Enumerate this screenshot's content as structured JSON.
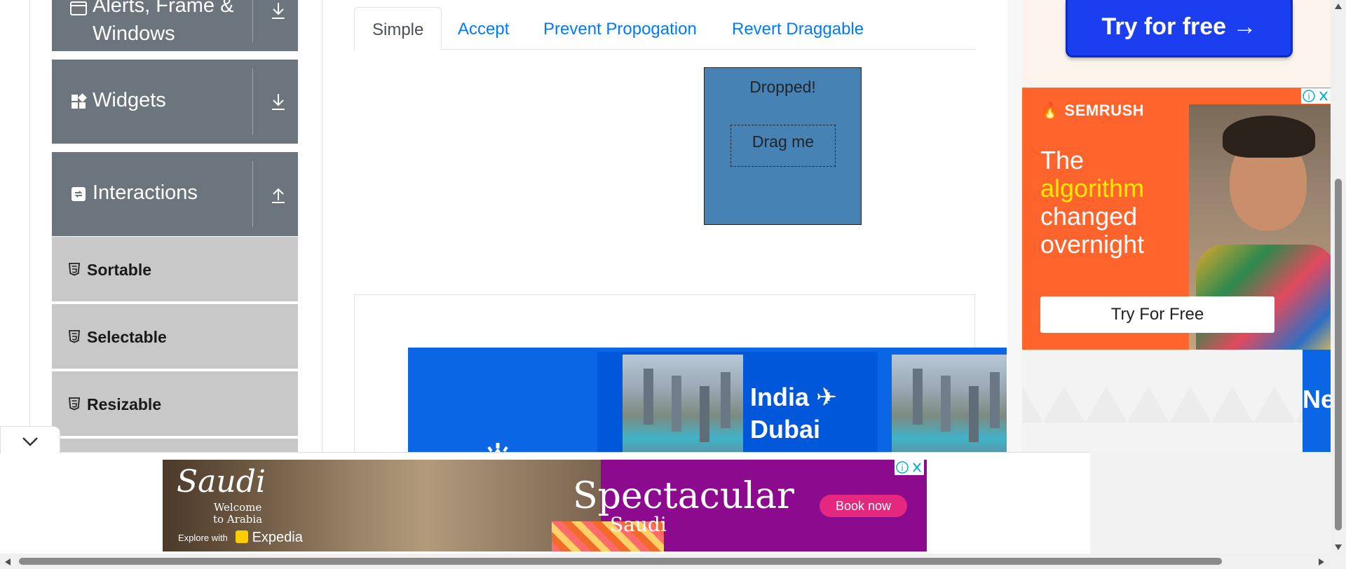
{
  "sidebar": {
    "groups": [
      {
        "label": "Alerts, Frame &\nWindows",
        "icon": "window-icon",
        "toggle": "down-arrow-icon"
      },
      {
        "label": "Widgets",
        "icon": "widgets-icon",
        "toggle": "down-arrow-icon"
      },
      {
        "label": "Interactions",
        "icon": "interactions-icon",
        "toggle": "up-arrow-icon"
      }
    ],
    "items": [
      {
        "label": "Sortable",
        "icon": "html5-icon"
      },
      {
        "label": "Selectable",
        "icon": "html5-icon"
      },
      {
        "label": "Resizable",
        "icon": "html5-icon"
      }
    ]
  },
  "tabs": [
    {
      "label": "Simple",
      "active": true
    },
    {
      "label": "Accept",
      "active": false
    },
    {
      "label": "Prevent Propogation",
      "active": false
    },
    {
      "label": "Revert Draggable",
      "active": false
    }
  ],
  "droppable": {
    "text": "Dropped!",
    "color": "#4682b4"
  },
  "draggable": {
    "text": "Drag me"
  },
  "flight_ad": {
    "route_line1": "India",
    "route_line2": "Dubai",
    "partial_text": "New"
  },
  "right_ads": {
    "top_button": "Try for free →",
    "semrush": {
      "logo": "SEMRUSH",
      "headline_1": "The",
      "headline_highlight": "algorithm",
      "headline_2": "changed",
      "headline_3": "overnight",
      "button": "Try For Free"
    }
  },
  "bottom_ad": {
    "brand": "Saudi",
    "welcome_1": "Welcome",
    "welcome_2": "to Arabia",
    "explore": "Explore with",
    "partner": "Expedia",
    "headline": "Spectacular",
    "subheadline": "Saudi",
    "cta": "Book now"
  },
  "colors": {
    "accent": "#007bff",
    "sidebar_group": "#6c757d",
    "sidebar_item": "#c8c8c8",
    "semrush": "#ff642d"
  }
}
